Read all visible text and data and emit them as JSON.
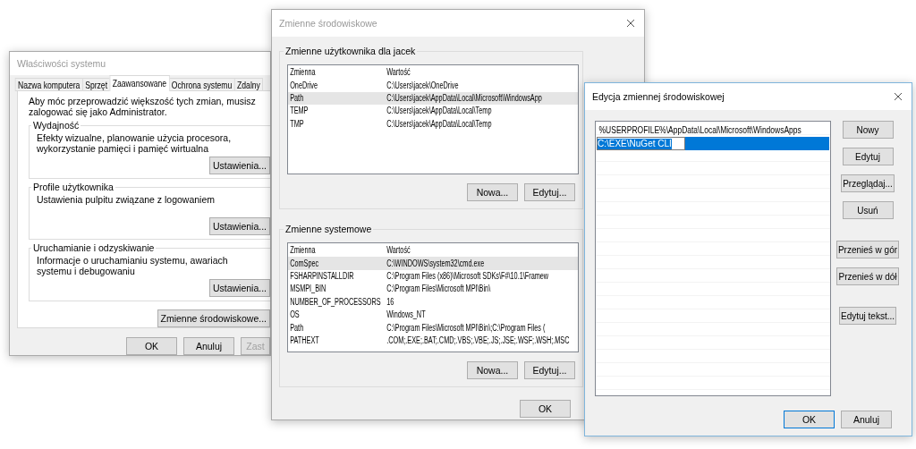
{
  "system_properties": {
    "title": "Właściwości systemu",
    "tabs": [
      {
        "label": "Nazwa komputera",
        "selected": false
      },
      {
        "label": "Sprzęt",
        "selected": false
      },
      {
        "label": "Zaawansowane",
        "selected": true
      },
      {
        "label": "Ochrona systemu",
        "selected": false
      },
      {
        "label": "Zdalny",
        "selected": false
      }
    ],
    "notice": "Aby móc przeprowadzić większość tych zmian, musisz zalogować się jako Administrator.",
    "groups": [
      {
        "title": "Wydajność",
        "description": "Efekty wizualne, planowanie użycia procesora, wykorzystanie pamięci i pamięć wirtualna",
        "button": "Ustawienia..."
      },
      {
        "title": "Profile użytkownika",
        "description": "Ustawienia pulpitu związane z logowaniem",
        "button": "Ustawienia..."
      },
      {
        "title": "Uruchamianie i odzyskiwanie",
        "description": "Informacje o uruchamianiu systemu, awariach systemu i debugowaniu",
        "button": "Ustawienia..."
      }
    ],
    "env_button": "Zmienne środowiskowe...",
    "buttons": [
      {
        "label": "OK",
        "disabled": false
      },
      {
        "label": "Anuluj",
        "disabled": false
      },
      {
        "label": "Zast",
        "disabled": true
      }
    ]
  },
  "environment_variables": {
    "title": "Zmienne środowiskowe",
    "user_section": {
      "title": "Zmienne użytkownika dla jacek",
      "columns": [
        "Zmienna",
        "Wartość"
      ],
      "rows": [
        {
          "name": "OneDrive",
          "value": "C:\\Users\\jacek\\OneDrive",
          "selected": false
        },
        {
          "name": "Path",
          "value": "C:\\Users\\jacek\\AppData\\Local\\Microsoft\\WindowsApp",
          "selected": true
        },
        {
          "name": "TEMP",
          "value": "C:\\Users\\jacek\\AppData\\Local\\Temp",
          "selected": false
        },
        {
          "name": "TMP",
          "value": "C:\\Users\\jacek\\AppData\\Local\\Temp",
          "selected": false
        }
      ],
      "buttons": [
        "Nowa...",
        "Edytuj..."
      ]
    },
    "system_section": {
      "title": "Zmienne systemowe",
      "columns": [
        "Zmienna",
        "Wartość"
      ],
      "rows": [
        {
          "name": "ComSpec",
          "value": "C:\\WINDOWS\\system32\\cmd.exe",
          "selected": true
        },
        {
          "name": "FSHARPINSTALLDIR",
          "value": "C:\\Program Files (x86)\\Microsoft SDKs\\F#\\10.1\\Framew",
          "selected": false
        },
        {
          "name": "MSMPI_BIN",
          "value": "C:\\Program Files\\Microsoft MPI\\Bin\\",
          "selected": false
        },
        {
          "name": "NUMBER_OF_PROCESSORS",
          "value": "16",
          "selected": false
        },
        {
          "name": "OS",
          "value": "Windows_NT",
          "selected": false
        },
        {
          "name": "Path",
          "value": "C:\\Program Files\\Microsoft MPI\\Bin\\;C:\\Program Files (",
          "selected": false
        },
        {
          "name": "PATHEXT",
          "value": ".COM;.EXE;.BAT;.CMD;.VBS;.VBE;.JS;.JSE;.WSF;.WSH;.MSC",
          "selected": false
        }
      ],
      "buttons": [
        "Nowa...",
        "Edytuj..."
      ]
    },
    "buttons": [
      "OK"
    ]
  },
  "edit_variable": {
    "title": "Edycja zmiennej środowiskowej",
    "entries": [
      {
        "text": "%USERPROFILE%\\AppData\\Local\\Microsoft\\WindowsApps",
        "selected": false
      },
      {
        "text": "C:\\EXE\\NuGet CLI",
        "selected": true
      }
    ],
    "side_buttons": [
      {
        "label": "Nowy",
        "kind": "action"
      },
      {
        "label": "Edytuj",
        "kind": "action"
      },
      {
        "label": "Przeglądaj...",
        "kind": "action"
      },
      {
        "label": "Usuń",
        "kind": "action"
      },
      {
        "label": "Przenieś w gór",
        "kind": "move"
      },
      {
        "label": "Przenieś w dół",
        "kind": "move"
      },
      {
        "label": "Edytuj tekst...",
        "kind": "text"
      }
    ],
    "buttons": [
      {
        "label": "OK",
        "default": true
      },
      {
        "label": "Anuluj",
        "default": false
      }
    ]
  }
}
